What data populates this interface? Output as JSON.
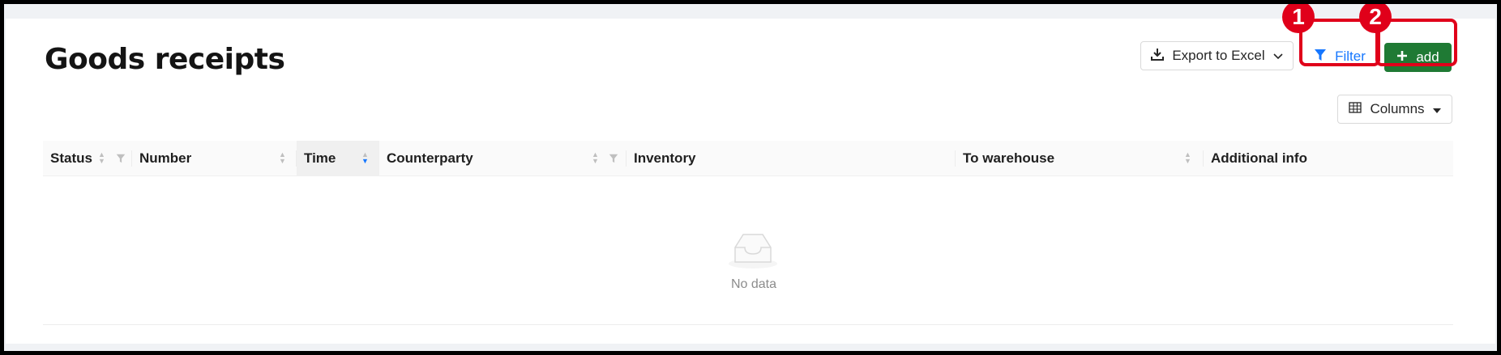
{
  "header": {
    "title": "Goods receipts",
    "export_label": "Export to Excel",
    "filter_label": "Filter",
    "add_label": "add",
    "columns_label": "Columns"
  },
  "annotations": [
    "1",
    "2"
  ],
  "table": {
    "columns": [
      {
        "label": "Status",
        "sortable": true,
        "filterable": true
      },
      {
        "label": "Number",
        "sortable": true,
        "filterable": false
      },
      {
        "label": "Time",
        "sortable": true,
        "filterable": false,
        "sorted": "descending"
      },
      {
        "label": "Counterparty",
        "sortable": true,
        "filterable": true
      },
      {
        "label": "Inventory",
        "sortable": false,
        "filterable": false
      },
      {
        "label": "To warehouse",
        "sortable": true,
        "filterable": false
      },
      {
        "label": "Additional info",
        "sortable": false,
        "filterable": false
      }
    ],
    "rows": [],
    "empty_text": "No data"
  },
  "colors": {
    "primary": "#1677ff",
    "add_button": "#1f7a34",
    "annotation": "#e0001a"
  },
  "icons": [
    "download-icon",
    "chevron-down-icon",
    "filter-icon",
    "plus-icon",
    "table-icon",
    "caret-down-icon",
    "sort-icon",
    "empty-inbox-icon"
  ]
}
